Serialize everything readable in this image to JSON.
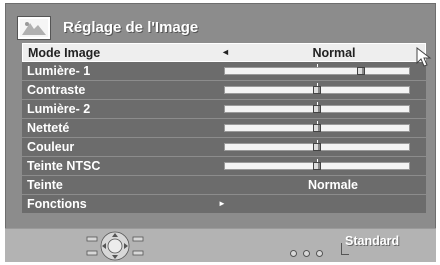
{
  "header": {
    "title": "Réglage de l'Image",
    "icon": "picture-settings-icon"
  },
  "menu": {
    "rows": [
      {
        "label": "Mode Image",
        "value": "Normal",
        "type": "choice",
        "selected": true
      },
      {
        "label": "Lumière- 1",
        "type": "slider",
        "level": 0.75
      },
      {
        "label": "Contraste",
        "type": "slider",
        "level": 0.5
      },
      {
        "label": "Lumière- 2",
        "type": "slider",
        "level": 0.5
      },
      {
        "label": "Netteté",
        "type": "slider",
        "level": 0.5
      },
      {
        "label": "Couleur",
        "type": "slider",
        "level": 0.5
      },
      {
        "label": "Teinte NTSC",
        "type": "slider",
        "level": 0.5
      },
      {
        "label": "Teinte",
        "value": "Normale",
        "type": "value"
      },
      {
        "label": "Fonctions",
        "type": "submenu"
      }
    ]
  },
  "arrows": {
    "left": "◄",
    "right": "►"
  },
  "footer": {
    "label": "Standard"
  },
  "colors": {
    "panel": "#8c8c8c",
    "row": "#6c6c6c",
    "selected_row": "#eeeeee",
    "footer": "#b3b3b3"
  }
}
